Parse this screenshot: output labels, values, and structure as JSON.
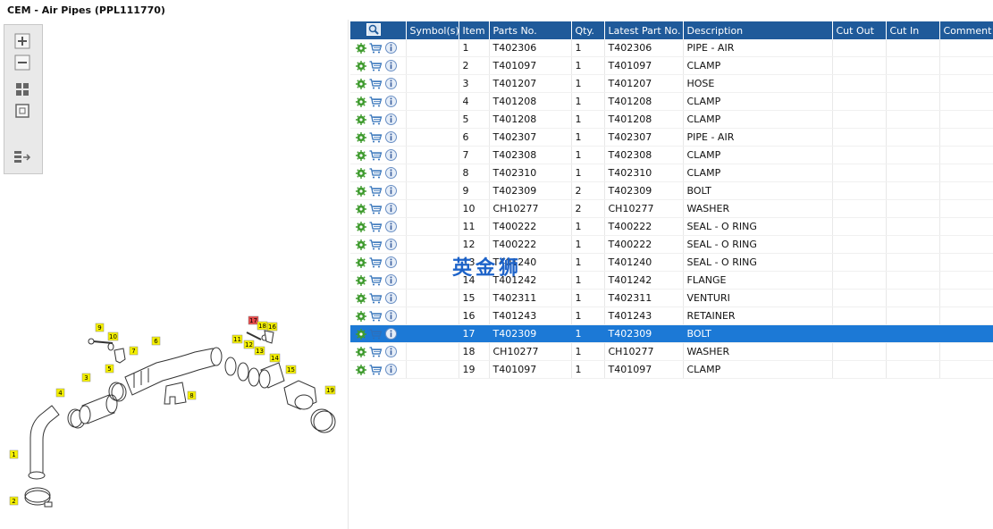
{
  "window": {
    "title": "CEM - Air Pipes (PPL111770)"
  },
  "toolbar": {
    "buttons": [
      "zoom-in",
      "zoom-out",
      "fit-all",
      "fit-page",
      "export"
    ]
  },
  "columns": [
    "",
    "Symbol(s)",
    "Item",
    "Parts No.",
    "Qty.",
    "Latest Part No.",
    "Description",
    "Cut Out",
    "Cut In",
    "Comment"
  ],
  "rows": [
    {
      "item": "1",
      "part": "T402306",
      "qty": "1",
      "latest": "T402306",
      "desc": "PIPE - AIR"
    },
    {
      "item": "2",
      "part": "T401097",
      "qty": "1",
      "latest": "T401097",
      "desc": "CLAMP"
    },
    {
      "item": "3",
      "part": "T401207",
      "qty": "1",
      "latest": "T401207",
      "desc": "HOSE"
    },
    {
      "item": "4",
      "part": "T401208",
      "qty": "1",
      "latest": "T401208",
      "desc": "CLAMP"
    },
    {
      "item": "5",
      "part": "T401208",
      "qty": "1",
      "latest": "T401208",
      "desc": "CLAMP"
    },
    {
      "item": "6",
      "part": "T402307",
      "qty": "1",
      "latest": "T402307",
      "desc": "PIPE - AIR"
    },
    {
      "item": "7",
      "part": "T402308",
      "qty": "1",
      "latest": "T402308",
      "desc": "CLAMP"
    },
    {
      "item": "8",
      "part": "T402310",
      "qty": "1",
      "latest": "T402310",
      "desc": "CLAMP"
    },
    {
      "item": "9",
      "part": "T402309",
      "qty": "2",
      "latest": "T402309",
      "desc": "BOLT"
    },
    {
      "item": "10",
      "part": "CH10277",
      "qty": "2",
      "latest": "CH10277",
      "desc": "WASHER"
    },
    {
      "item": "11",
      "part": "T400222",
      "qty": "1",
      "latest": "T400222",
      "desc": "SEAL - O RING"
    },
    {
      "item": "12",
      "part": "T400222",
      "qty": "1",
      "latest": "T400222",
      "desc": "SEAL - O RING"
    },
    {
      "item": "13",
      "part": "T401240",
      "qty": "1",
      "latest": "T401240",
      "desc": "SEAL - O RING"
    },
    {
      "item": "14",
      "part": "T401242",
      "qty": "1",
      "latest": "T401242",
      "desc": "FLANGE"
    },
    {
      "item": "15",
      "part": "T402311",
      "qty": "1",
      "latest": "T402311",
      "desc": "VENTURI"
    },
    {
      "item": "16",
      "part": "T401243",
      "qty": "1",
      "latest": "T401243",
      "desc": "RETAINER"
    },
    {
      "item": "17",
      "part": "T402309",
      "qty": "1",
      "latest": "T402309",
      "desc": "BOLT",
      "selected": true
    },
    {
      "item": "18",
      "part": "CH10277",
      "qty": "1",
      "latest": "CH10277",
      "desc": "WASHER"
    },
    {
      "item": "19",
      "part": "T401097",
      "qty": "1",
      "latest": "T401097",
      "desc": "CLAMP"
    }
  ],
  "watermark": "英金狮",
  "callouts": [
    "1",
    "2",
    "3",
    "4",
    "5",
    "6",
    "7",
    "8",
    "9",
    "10",
    "11",
    "12",
    "13",
    "14",
    "15",
    "16",
    "17",
    "18",
    "19"
  ],
  "colors": {
    "header": "#1f5a9a",
    "selected": "#1c79d6",
    "callout": "#f5f000",
    "callout_active": "#e84a4a"
  }
}
